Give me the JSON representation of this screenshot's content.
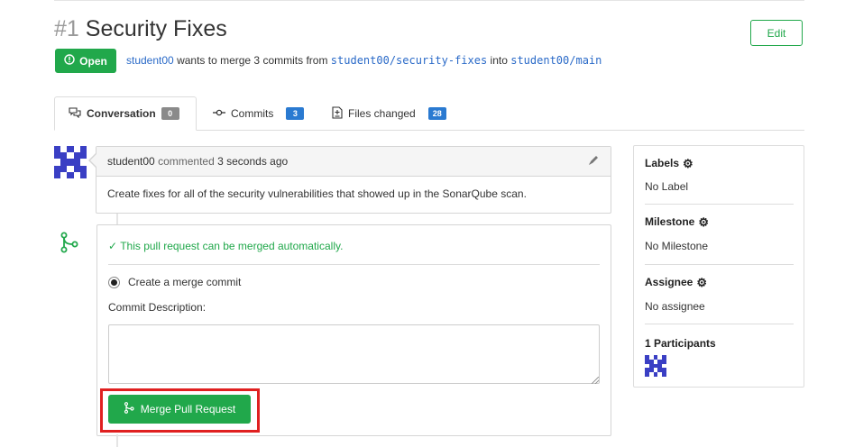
{
  "header": {
    "number": "#1",
    "title": "Security Fixes",
    "edit_label": "Edit",
    "status_label": "Open",
    "author": "student00",
    "merge_text_1": "wants to merge 3 commits from",
    "source_branch": "student00/security-fixes",
    "merge_text_2": "into",
    "target_branch": "student00/main"
  },
  "tabs": [
    {
      "label": "Conversation",
      "count": "0"
    },
    {
      "label": "Commits",
      "count": "3"
    },
    {
      "label": "Files changed",
      "count": "28"
    }
  ],
  "comment": {
    "author": "student00",
    "action": "commented",
    "time": "3 seconds ago",
    "body": "Create fixes for all of the security vulnerabilities that showed up in the SonarQube scan."
  },
  "merge": {
    "status_text": "This pull request can be merged automatically.",
    "option_label": "Create a merge commit",
    "description_label": "Commit Description:",
    "description_value": "",
    "button_label": "Merge Pull Request"
  },
  "sidebar": {
    "labels_heading": "Labels",
    "labels_value": "No Label",
    "milestone_heading": "Milestone",
    "milestone_value": "No Milestone",
    "assignee_heading": "Assignee",
    "assignee_value": "No assignee",
    "participants_heading": "1 Participants"
  },
  "colors": {
    "accent_green": "#21a84b",
    "link_blue": "#2a6ac8",
    "highlight_red": "#e02020",
    "avatar_blue": "#3a3fc4"
  },
  "icons": [
    "alert-circle-icon",
    "conversation-icon",
    "commit-icon",
    "file-diff-icon",
    "pencil-icon",
    "git-merge-icon",
    "check-icon",
    "gear-icon"
  ]
}
